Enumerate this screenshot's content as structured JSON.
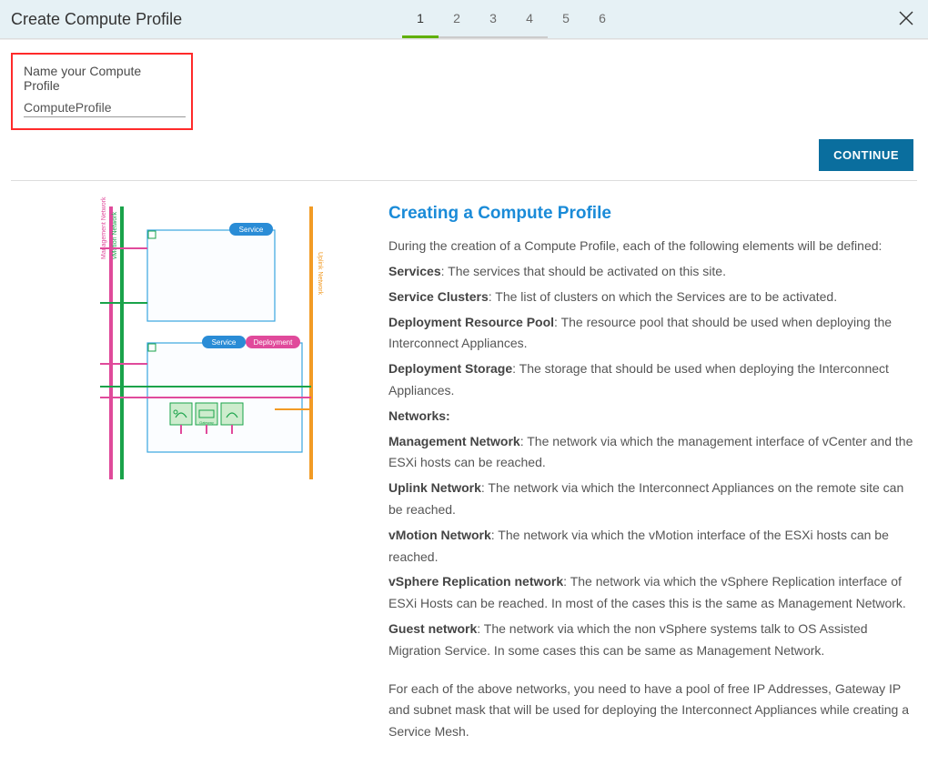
{
  "header": {
    "title": "Create Compute Profile",
    "close_label": "Close"
  },
  "steps": [
    "1",
    "2",
    "3",
    "4",
    "5",
    "6"
  ],
  "active_step": 0,
  "form": {
    "name_label": "Name your Compute Profile",
    "name_value": "ComputeProfile"
  },
  "buttons": {
    "continue": "CONTINUE"
  },
  "info": {
    "heading": "Creating a Compute Profile",
    "intro": "During the creation of a Compute Profile, each of the following elements will be defined:",
    "services_label": "Services",
    "services_text": ": The services that should be activated on this site.",
    "clusters_label": "Service Clusters",
    "clusters_text": ": The list of clusters on which the Services are to be activated.",
    "drp_label": "Deployment Resource Pool",
    "drp_text": ": The resource pool that should be used when deploying the Interconnect Appliances.",
    "ds_label": "Deployment Storage",
    "ds_text": ": The storage that should be used when deploying the Interconnect Appliances.",
    "networks_label": "Networks:",
    "mgmt_label": "Management Network",
    "mgmt_text": ": The network via which the management interface of vCenter and the ESXi hosts can be reached.",
    "uplink_label": "Uplink Network",
    "uplink_text": ": The network via which the Interconnect Appliances on the remote site can be reached.",
    "vmotion_label": "vMotion Network",
    "vmotion_text": ": The network via which the vMotion interface of the ESXi hosts can be reached.",
    "vsr_label": "vSphere Replication network",
    "vsr_text": ": The network via which the vSphere Replication interface of ESXi Hosts can be reached. In most of the cases this is the same as Management Network.",
    "guest_label": "Guest network",
    "guest_text": ": The network via which the non vSphere systems talk to OS Assisted Migration Service. In some cases this can be same as Management Network.",
    "footer": "For each of the above networks, you need to have a pool of free IP Addresses, Gateway IP and subnet mask that will be used for deploying the Interconnect Appliances while creating a Service Mesh."
  },
  "diagram": {
    "mgmt_label": "Management Network",
    "vmotion_label": "vMotion Network",
    "uplink_label": "Uplink Network",
    "service_pill": "Service",
    "deployment_pill": "Deployment"
  }
}
